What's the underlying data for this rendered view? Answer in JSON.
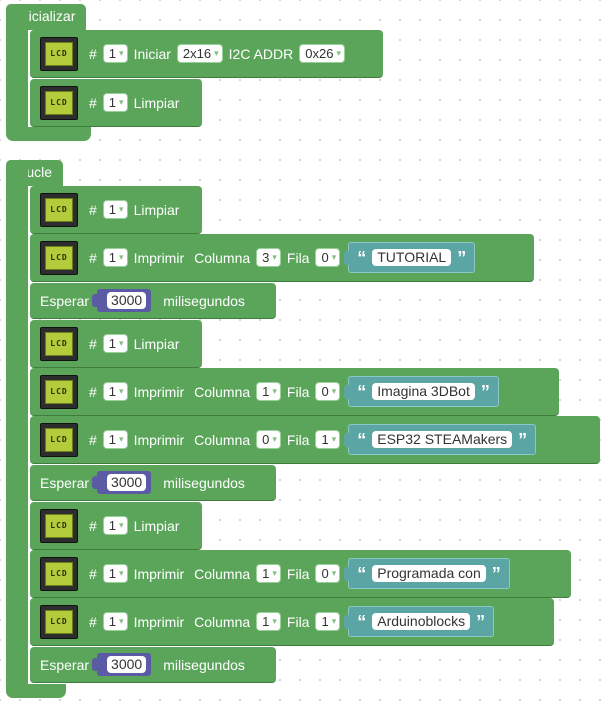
{
  "init": {
    "title": "Inicializar",
    "blocks": [
      {
        "lcd": "LCD",
        "hash": "#",
        "num": "1",
        "action": "Iniciar",
        "size": "2x16",
        "addr_label": "I2C ADDR",
        "addr": "0x26"
      },
      {
        "lcd": "LCD",
        "hash": "#",
        "num": "1",
        "action": "Limpiar"
      }
    ]
  },
  "loop": {
    "title": "Bucle",
    "blocks": [
      {
        "type": "clear",
        "lcd": "LCD",
        "hash": "#",
        "num": "1",
        "action": "Limpiar"
      },
      {
        "type": "print",
        "lcd": "LCD",
        "hash": "#",
        "num": "1",
        "action": "Imprimir",
        "col_label": "Columna",
        "col": "3",
        "row_label": "Fila",
        "row": "0",
        "quote_open": "“",
        "text": "TUTORIAL",
        "quote_close": "”"
      },
      {
        "type": "wait",
        "label": "Esperar",
        "value": "3000",
        "unit": "milisegundos"
      },
      {
        "type": "clear",
        "lcd": "LCD",
        "hash": "#",
        "num": "1",
        "action": "Limpiar"
      },
      {
        "type": "print",
        "lcd": "LCD",
        "hash": "#",
        "num": "1",
        "action": "Imprimir",
        "col_label": "Columna",
        "col": "1",
        "row_label": "Fila",
        "row": "0",
        "quote_open": "“",
        "text": "Imagina 3DBot",
        "quote_close": "”"
      },
      {
        "type": "print",
        "lcd": "LCD",
        "hash": "#",
        "num": "1",
        "action": "Imprimir",
        "col_label": "Columna",
        "col": "0",
        "row_label": "Fila",
        "row": "1",
        "quote_open": "“",
        "text": "ESP32 STEAMakers",
        "quote_close": "”"
      },
      {
        "type": "wait",
        "label": "Esperar",
        "value": "3000",
        "unit": "milisegundos"
      },
      {
        "type": "clear",
        "lcd": "LCD",
        "hash": "#",
        "num": "1",
        "action": "Limpiar"
      },
      {
        "type": "print",
        "lcd": "LCD",
        "hash": "#",
        "num": "1",
        "action": "Imprimir",
        "col_label": "Columna",
        "col": "1",
        "row_label": "Fila",
        "row": "0",
        "quote_open": "“",
        "text": "Programada con",
        "quote_close": "”"
      },
      {
        "type": "print",
        "lcd": "LCD",
        "hash": "#",
        "num": "1",
        "action": "Imprimir",
        "col_label": "Columna",
        "col": "1",
        "row_label": "Fila",
        "row": "1",
        "quote_open": "“",
        "text": "Arduinoblocks",
        "quote_close": "”"
      },
      {
        "type": "wait",
        "label": "Esperar",
        "value": "3000",
        "unit": "milisegundos"
      }
    ]
  },
  "dropdown_arrow": "▾",
  "colors": {
    "block_green": "#5ba55b",
    "text_teal": "#5ba5a5",
    "number_purple": "#5b5ba5",
    "lcd_screen": "#b4cc3c"
  }
}
